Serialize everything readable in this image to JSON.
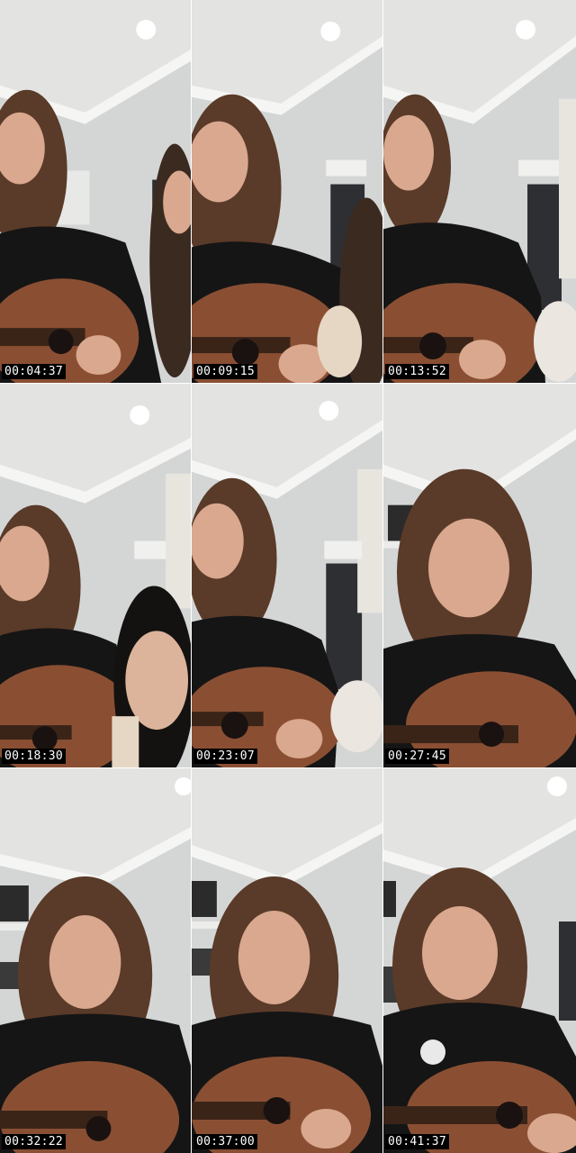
{
  "frames": [
    {
      "timestamp": "00:04:37"
    },
    {
      "timestamp": "00:09:15"
    },
    {
      "timestamp": "00:13:52"
    },
    {
      "timestamp": "00:18:30"
    },
    {
      "timestamp": "00:23:07"
    },
    {
      "timestamp": "00:27:45"
    },
    {
      "timestamp": "00:32:22"
    },
    {
      "timestamp": "00:37:00"
    },
    {
      "timestamp": "00:41:37"
    }
  ],
  "colors": {
    "ceiling": "#e3e3e1",
    "wall": "#d4d6d6",
    "cove": "#f5f5f3",
    "door": "#2e2f33",
    "hair": "#5a3a28",
    "skin": "#d9a88e",
    "shirt": "#151515",
    "guitar_body": "#8a4f33",
    "guitar_neck": "#3a2418",
    "timestamp_bg": "#000000",
    "timestamp_text": "#ffffff"
  }
}
